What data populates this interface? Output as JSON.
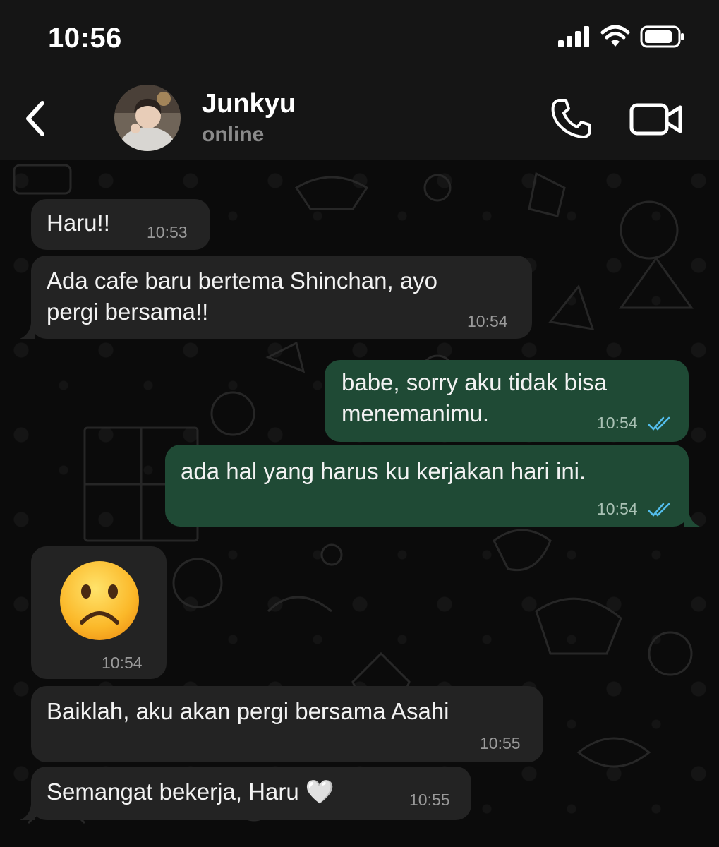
{
  "status_bar": {
    "time": "10:56"
  },
  "header": {
    "contact_name": "Junkyu",
    "contact_status": "online"
  },
  "messages": [
    {
      "direction": "in",
      "text_lines": [
        "Haru!!"
      ],
      "time": "10:53"
    },
    {
      "direction": "in",
      "text_lines": [
        "Ada cafe baru bertema Shinchan, ayo",
        "pergi bersama!!"
      ],
      "time": "10:54"
    },
    {
      "direction": "out",
      "text_lines": [
        "babe, sorry aku tidak bisa",
        "menemanimu."
      ],
      "time": "10:54",
      "read": true
    },
    {
      "direction": "out",
      "text_lines": [
        "ada hal yang harus ku kerjakan hari ini."
      ],
      "time": "10:54",
      "read": true
    },
    {
      "direction": "in",
      "type": "emoji",
      "emoji": "frowning-face",
      "time": "10:54"
    },
    {
      "direction": "in",
      "text_lines": [
        "Baiklah, aku akan pergi bersama Asahi"
      ],
      "time": "10:55"
    },
    {
      "direction": "in",
      "text_lines": [
        "Semangat bekerja, Haru 🤍"
      ],
      "time": "10:55"
    }
  ],
  "colors": {
    "background": "#0b0b0b",
    "bar": "#151515",
    "incoming_bubble": "#232323",
    "outgoing_bubble": "#1f4a35",
    "read_ticks": "#53bdeb"
  },
  "icons": [
    "back-chevron-icon",
    "phone-icon",
    "video-camera-icon",
    "signal-icon",
    "wifi-icon",
    "battery-icon",
    "double-check-icon",
    "frowning-face-emoji"
  ]
}
